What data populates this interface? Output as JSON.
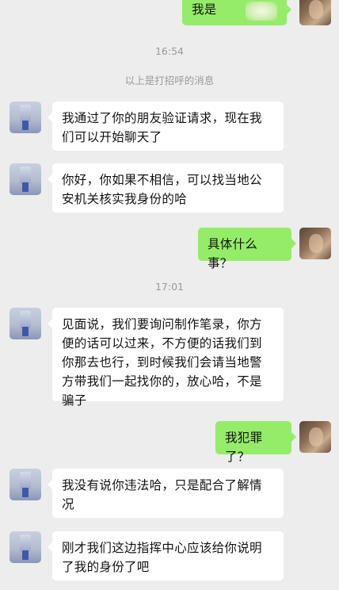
{
  "messages": {
    "m0": "我是",
    "t1": "16:54",
    "s1": "以上是打招呼的消息",
    "m1": "我通过了你的朋友验证请求，现在我们可以开始聊天了",
    "m2": "你好，你如果不相信，可以找当地公安机关核实我身份的哈",
    "m3": "具体什么事？",
    "t2": "17:01",
    "m4": "见面说，我们要询问制作笔录，你方便的话可以过来，不方便的话我们到你那去也行，到时候我们会请当地警方带我们一起找你的，放心哈，不是骗子",
    "m5": "我犯罪了？",
    "m6": "我没有说你违法哈，只是配合了解情况",
    "m7": "刚才我们这边指挥中心应该给你说明了我的身份了吧"
  },
  "colors": {
    "background": "#ededed",
    "self_bubble": "#95ec69",
    "other_bubble": "#ffffff",
    "meta_text": "#9a9a9a"
  }
}
